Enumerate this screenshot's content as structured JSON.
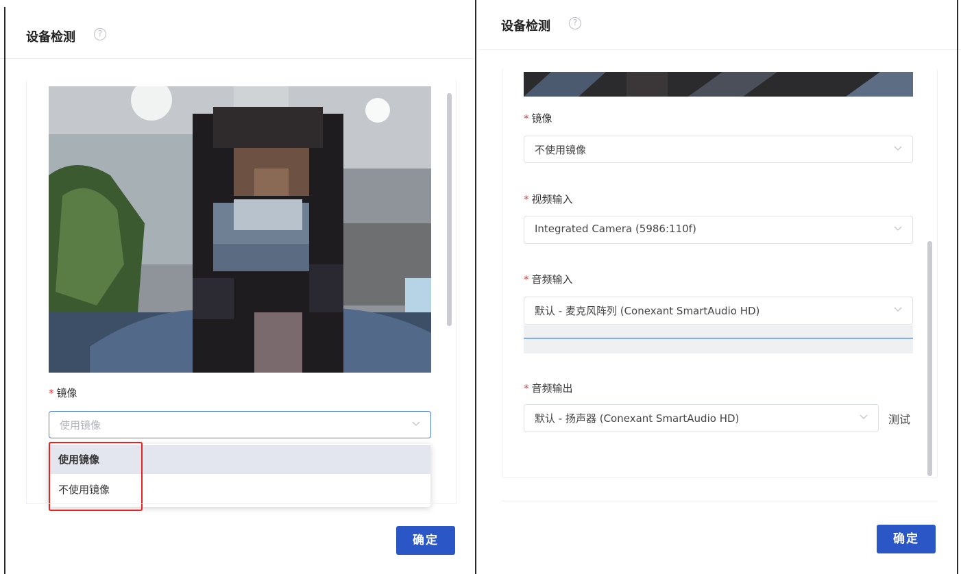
{
  "left": {
    "title": "设备检测",
    "mirror_label": "镜像",
    "mirror_placeholder": "使用镜像",
    "options": [
      "使用镜像",
      "不使用镜像"
    ],
    "confirm": "确定"
  },
  "right": {
    "title": "设备检测",
    "mirror_label": "镜像",
    "mirror_value": "不使用镜像",
    "video_label": "视频输入",
    "video_value": "Integrated Camera (5986:110f)",
    "audio_in_label": "音频输入",
    "audio_in_value": "默认 - 麦克风阵列 (Conexant SmartAudio HD)",
    "audio_out_label": "音频输出",
    "audio_out_value": "默认 - 扬声器 (Conexant SmartAudio HD)",
    "test": "测试",
    "confirm": "确定"
  },
  "icons": {
    "help": "help-circle-icon",
    "chevron": "chevron-down-icon"
  },
  "colors": {
    "primary": "#2a56c6",
    "required": "#e23a3a",
    "highlight": "#e32222"
  }
}
